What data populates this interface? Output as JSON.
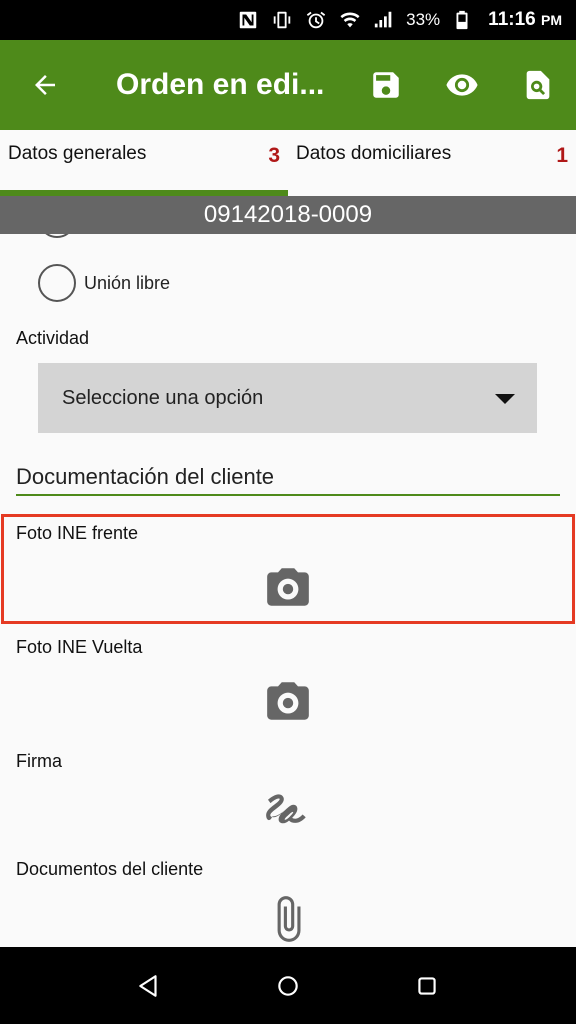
{
  "status_bar": {
    "battery_pct": "33%",
    "time": "11:16",
    "time_suffix": "PM",
    "icons": [
      "nfc-icon",
      "vibrate-icon",
      "alarm-icon",
      "wifi-icon",
      "cell-signal-icon",
      "battery-icon"
    ]
  },
  "app_bar": {
    "title": "Orden en edi...",
    "actions": [
      "save-icon",
      "eye-icon",
      "search-document-icon"
    ]
  },
  "tabs": [
    {
      "label": "Datos generales",
      "count": "3",
      "active": true
    },
    {
      "label": "Datos domiciliares",
      "count": "1",
      "active": false
    }
  ],
  "order_number": "09142018-0009",
  "form": {
    "radio_option": "Unión libre",
    "activity_label": "Actividad",
    "activity_select": "Seleccione una opción",
    "section_title": "Documentación del cliente",
    "documents": [
      {
        "label": "Foto INE frente",
        "icon": "camera-icon",
        "highlighted": true
      },
      {
        "label": "Foto INE Vuelta",
        "icon": "camera-icon",
        "highlighted": false
      },
      {
        "label": "Firma",
        "icon": "signature-icon",
        "highlighted": false
      },
      {
        "label": "Documentos del cliente",
        "icon": "paperclip-icon",
        "highlighted": false
      }
    ]
  },
  "colors": {
    "primary": "#4e8a1a",
    "badge": "#b01818",
    "strip": "#666666",
    "highlight": "#e53a23"
  }
}
